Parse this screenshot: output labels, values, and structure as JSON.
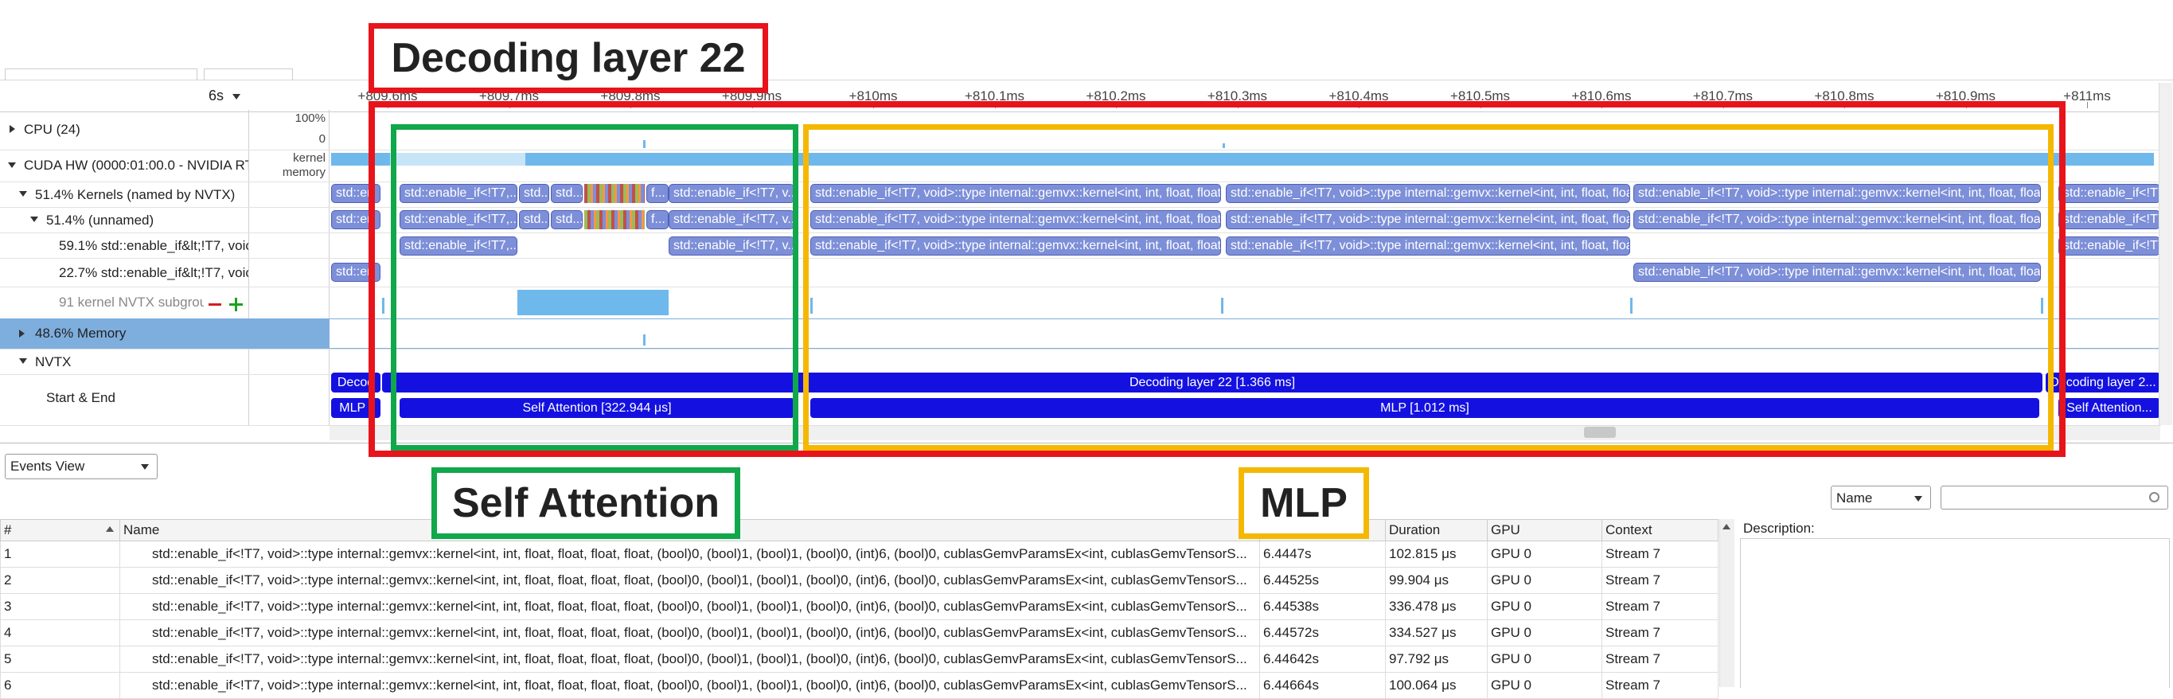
{
  "timeline": {
    "zoom_label": "6s",
    "ticks": [
      "+809.6ms",
      "+809.7ms",
      "+809.8ms",
      "+809.9ms",
      "+810ms",
      "+810.1ms",
      "+810.2ms",
      "+810.3ms",
      "+810.4ms",
      "+810.5ms",
      "+810.6ms",
      "+810.7ms",
      "+810.8ms",
      "+810.9ms",
      "+811ms"
    ],
    "rows": {
      "cpu": "CPU (24)",
      "cpu_scale_top": "100%",
      "cpu_scale_bottom": "0",
      "cuda": "CUDA HW (0000:01:00.0 - NVIDIA RT",
      "cuda_sub1": "kernel",
      "cuda_sub2": "memory",
      "kernels": "51.4% Kernels (named by NVTX)",
      "unnamed": "51.4% (unnamed)",
      "k591": "59.1% std::enable_if&lt;!T7, voic",
      "k227": "22.7% std::enable_if&lt;!T7, voic",
      "subgroup": "91 kernel NVTX subgrou",
      "memory": "48.6% Memory",
      "nvtx": "NVTX",
      "startend": "Start & End"
    },
    "kernels": {
      "short": "std::en",
      "ifT7_trunc": "std::enable_if<!T7,...",
      "std_dot": "std...",
      "f": "f...",
      "v_trunc": "std::enable_if<!T7, v...",
      "gemvx_a": "std::enable_if<!T7, void>::type internal::gemvx::kernel<int, int, float, float,...",
      "gemvx_b": "std::enable_if<!T7, void>::type internal::gemvx::kernel<int, int, float, floa...",
      "right_edge": "std::enable_if<!T7, void>::type internal::gemvx::kernel<int, int, float, floa...",
      "far_right": "std::enable_if<!T7, ...",
      "far_right2": "std::enable_if<!T7, ..."
    },
    "nvtx": {
      "decode_left": "Decod",
      "decoding_layer": "Decoding layer 22 [1.366 ms]",
      "decode_right": "Decoding layer 2...",
      "mlp_left": "MLP [",
      "self_attention": "Self Attention [322.944 μs]",
      "mlp": "MLP [1.012 ms]",
      "self_attention_right": "Self Attention..."
    }
  },
  "annotations": {
    "decoding": "Decoding layer 22",
    "self_attention": "Self Attention",
    "mlp": "MLP",
    "red": "#e8141b",
    "green": "#10a84a",
    "orange": "#f5b800"
  },
  "events": {
    "view_label": "Events View",
    "sort_label": "Name",
    "description_label": "Description:",
    "columns": [
      "#",
      "Name",
      "",
      "Duration",
      "GPU",
      "Context"
    ],
    "rows": [
      {
        "n": "1",
        "name": "std::enable_if<!T7, void>::type internal::gemvx::kernel<int, int, float, float, float, float, (bool)0, (bool)1, (bool)1, (bool)0, (int)6, (bool)0, cublasGemvParamsEx<int, cublasGemvTensorS...",
        "start": "6.4447s",
        "duration": "102.815 μs",
        "gpu": "GPU 0",
        "context": "Stream 7"
      },
      {
        "n": "2",
        "name": "std::enable_if<!T7, void>::type internal::gemvx::kernel<int, int, float, float, float, float, (bool)0, (bool)1, (bool)1, (bool)0, (int)6, (bool)0, cublasGemvParamsEx<int, cublasGemvTensorS...",
        "start": "6.44525s",
        "duration": "99.904 μs",
        "gpu": "GPU 0",
        "context": "Stream 7"
      },
      {
        "n": "3",
        "name": "std::enable_if<!T7, void>::type internal::gemvx::kernel<int, int, float, float, float, float, (bool)0, (bool)1, (bool)1, (bool)0, (int)6, (bool)0, cublasGemvParamsEx<int, cublasGemvTensorS...",
        "start": "6.44538s",
        "duration": "336.478 μs",
        "gpu": "GPU 0",
        "context": "Stream 7"
      },
      {
        "n": "4",
        "name": "std::enable_if<!T7, void>::type internal::gemvx::kernel<int, int, float, float, float, float, (bool)0, (bool)1, (bool)1, (bool)0, (int)6, (bool)0, cublasGemvParamsEx<int, cublasGemvTensorS...",
        "start": "6.44572s",
        "duration": "334.527 μs",
        "gpu": "GPU 0",
        "context": "Stream 7"
      },
      {
        "n": "5",
        "name": "std::enable_if<!T7, void>::type internal::gemvx::kernel<int, int, float, float, float, float, (bool)0, (bool)1, (bool)1, (bool)0, (int)6, (bool)0, cublasGemvParamsEx<int, cublasGemvTensorS...",
        "start": "6.44642s",
        "duration": "97.792 μs",
        "gpu": "GPU 0",
        "context": "Stream 7"
      },
      {
        "n": "6",
        "name": "std::enable_if<!T7, void>::type internal::gemvx::kernel<int, int, float, float, float, float, (bool)0, (bool)1, (bool)1, (bool)0, (int)6, (bool)0, cublasGemvParamsEx<int, cublasGemvTensorS...",
        "start": "6.44664s",
        "duration": "100.064 μs",
        "gpu": "GPU 0",
        "context": "Stream 7"
      }
    ]
  }
}
